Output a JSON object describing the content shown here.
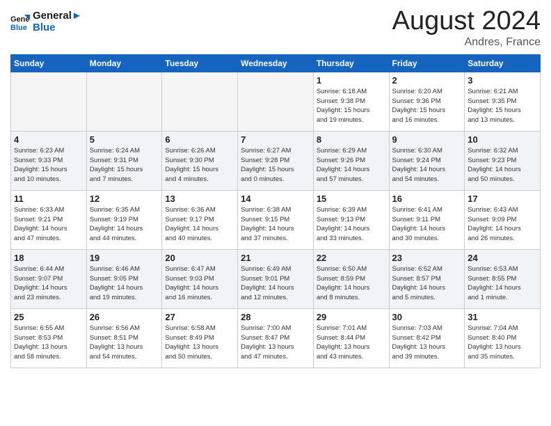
{
  "logo": {
    "line1": "General",
    "line2": "Blue"
  },
  "title": "August 2024",
  "location": "Andres, France",
  "days_of_week": [
    "Sunday",
    "Monday",
    "Tuesday",
    "Wednesday",
    "Thursday",
    "Friday",
    "Saturday"
  ],
  "weeks": [
    [
      {
        "num": "",
        "info": "",
        "empty": true
      },
      {
        "num": "",
        "info": "",
        "empty": true
      },
      {
        "num": "",
        "info": "",
        "empty": true
      },
      {
        "num": "",
        "info": "",
        "empty": true
      },
      {
        "num": "1",
        "info": "Sunrise: 6:18 AM\nSunset: 9:38 PM\nDaylight: 15 hours\nand 19 minutes."
      },
      {
        "num": "2",
        "info": "Sunrise: 6:20 AM\nSunset: 9:36 PM\nDaylight: 15 hours\nand 16 minutes."
      },
      {
        "num": "3",
        "info": "Sunrise: 6:21 AM\nSunset: 9:35 PM\nDaylight: 15 hours\nand 13 minutes."
      }
    ],
    [
      {
        "num": "4",
        "info": "Sunrise: 6:23 AM\nSunset: 9:33 PM\nDaylight: 15 hours\nand 10 minutes."
      },
      {
        "num": "5",
        "info": "Sunrise: 6:24 AM\nSunset: 9:31 PM\nDaylight: 15 hours\nand 7 minutes."
      },
      {
        "num": "6",
        "info": "Sunrise: 6:26 AM\nSunset: 9:30 PM\nDaylight: 15 hours\nand 4 minutes."
      },
      {
        "num": "7",
        "info": "Sunrise: 6:27 AM\nSunset: 9:28 PM\nDaylight: 15 hours\nand 0 minutes."
      },
      {
        "num": "8",
        "info": "Sunrise: 6:29 AM\nSunset: 9:26 PM\nDaylight: 14 hours\nand 57 minutes."
      },
      {
        "num": "9",
        "info": "Sunrise: 6:30 AM\nSunset: 9:24 PM\nDaylight: 14 hours\nand 54 minutes."
      },
      {
        "num": "10",
        "info": "Sunrise: 6:32 AM\nSunset: 9:23 PM\nDaylight: 14 hours\nand 50 minutes."
      }
    ],
    [
      {
        "num": "11",
        "info": "Sunrise: 6:33 AM\nSunset: 9:21 PM\nDaylight: 14 hours\nand 47 minutes."
      },
      {
        "num": "12",
        "info": "Sunrise: 6:35 AM\nSunset: 9:19 PM\nDaylight: 14 hours\nand 44 minutes."
      },
      {
        "num": "13",
        "info": "Sunrise: 6:36 AM\nSunset: 9:17 PM\nDaylight: 14 hours\nand 40 minutes."
      },
      {
        "num": "14",
        "info": "Sunrise: 6:38 AM\nSunset: 9:15 PM\nDaylight: 14 hours\nand 37 minutes."
      },
      {
        "num": "15",
        "info": "Sunrise: 6:39 AM\nSunset: 9:13 PM\nDaylight: 14 hours\nand 33 minutes."
      },
      {
        "num": "16",
        "info": "Sunrise: 6:41 AM\nSunset: 9:11 PM\nDaylight: 14 hours\nand 30 minutes."
      },
      {
        "num": "17",
        "info": "Sunrise: 6:43 AM\nSunset: 9:09 PM\nDaylight: 14 hours\nand 26 minutes."
      }
    ],
    [
      {
        "num": "18",
        "info": "Sunrise: 6:44 AM\nSunset: 9:07 PM\nDaylight: 14 hours\nand 23 minutes."
      },
      {
        "num": "19",
        "info": "Sunrise: 6:46 AM\nSunset: 9:05 PM\nDaylight: 14 hours\nand 19 minutes."
      },
      {
        "num": "20",
        "info": "Sunrise: 6:47 AM\nSunset: 9:03 PM\nDaylight: 14 hours\nand 16 minutes."
      },
      {
        "num": "21",
        "info": "Sunrise: 6:49 AM\nSunset: 9:01 PM\nDaylight: 14 hours\nand 12 minutes."
      },
      {
        "num": "22",
        "info": "Sunrise: 6:50 AM\nSunset: 8:59 PM\nDaylight: 14 hours\nand 8 minutes."
      },
      {
        "num": "23",
        "info": "Sunrise: 6:52 AM\nSunset: 8:57 PM\nDaylight: 14 hours\nand 5 minutes."
      },
      {
        "num": "24",
        "info": "Sunrise: 6:53 AM\nSunset: 8:55 PM\nDaylight: 14 hours\nand 1 minute."
      }
    ],
    [
      {
        "num": "25",
        "info": "Sunrise: 6:55 AM\nSunset: 8:53 PM\nDaylight: 13 hours\nand 58 minutes."
      },
      {
        "num": "26",
        "info": "Sunrise: 6:56 AM\nSunset: 8:51 PM\nDaylight: 13 hours\nand 54 minutes."
      },
      {
        "num": "27",
        "info": "Sunrise: 6:58 AM\nSunset: 8:49 PM\nDaylight: 13 hours\nand 50 minutes."
      },
      {
        "num": "28",
        "info": "Sunrise: 7:00 AM\nSunset: 8:47 PM\nDaylight: 13 hours\nand 47 minutes."
      },
      {
        "num": "29",
        "info": "Sunrise: 7:01 AM\nSunset: 8:44 PM\nDaylight: 13 hours\nand 43 minutes."
      },
      {
        "num": "30",
        "info": "Sunrise: 7:03 AM\nSunset: 8:42 PM\nDaylight: 13 hours\nand 39 minutes."
      },
      {
        "num": "31",
        "info": "Sunrise: 7:04 AM\nSunset: 8:40 PM\nDaylight: 13 hours\nand 35 minutes."
      }
    ]
  ]
}
